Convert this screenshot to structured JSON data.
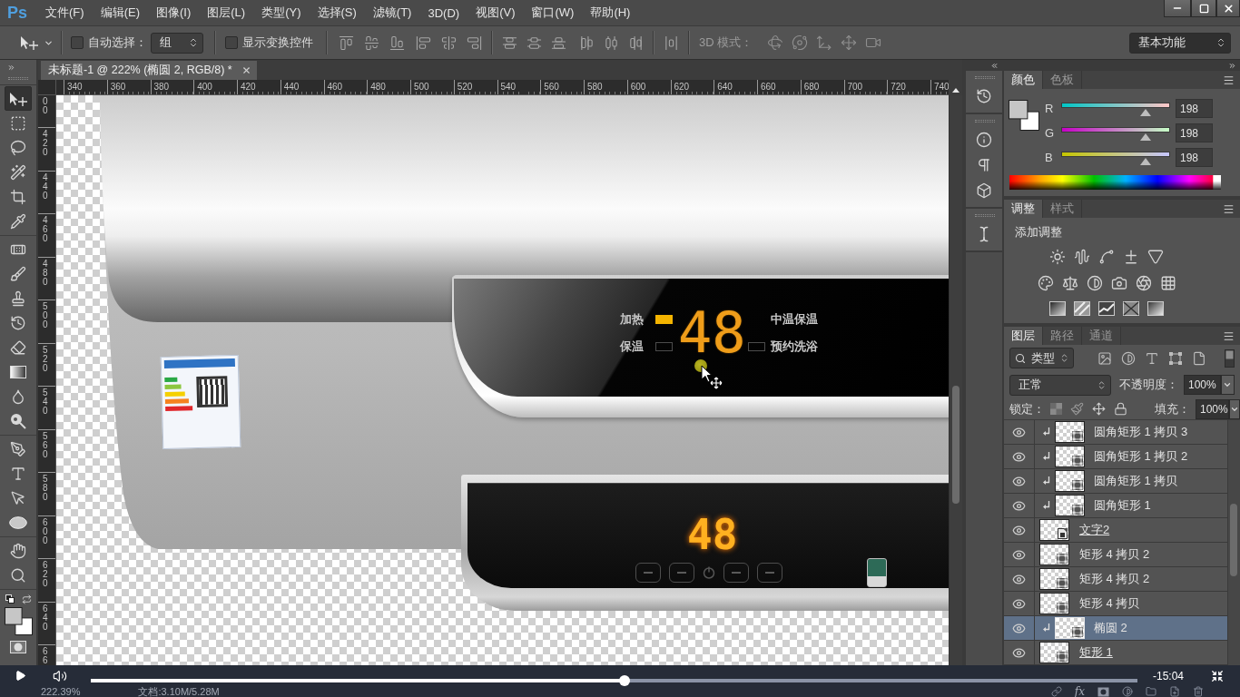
{
  "app_logo": "Ps",
  "menu": [
    "文件(F)",
    "编辑(E)",
    "图像(I)",
    "图层(L)",
    "类型(Y)",
    "选择(S)",
    "滤镜(T)",
    "3D(D)",
    "视图(V)",
    "窗口(W)",
    "帮助(H)"
  ],
  "options_bar": {
    "auto_select": {
      "label": "自动选择：",
      "checked": false
    },
    "auto_select_target": "组",
    "show_transform": {
      "label": "显示变换控件",
      "checked": false
    },
    "mode_3d_label": "3D 模式：",
    "workspace": "基本功能"
  },
  "tool_groups": [
    {
      "tools": [
        {
          "kind": "move",
          "selected": true
        },
        {
          "kind": "marquee",
          "selected": false
        },
        {
          "kind": "lasso",
          "selected": false
        },
        {
          "kind": "wand",
          "selected": false
        },
        {
          "kind": "crop",
          "selected": false
        },
        {
          "kind": "eyedropper",
          "selected": false
        }
      ]
    },
    {
      "tools": [
        {
          "kind": "healing",
          "selected": false
        },
        {
          "kind": "brush",
          "selected": false
        },
        {
          "kind": "stamp",
          "selected": false
        },
        {
          "kind": "history",
          "selected": false
        },
        {
          "kind": "eraser",
          "selected": false
        },
        {
          "kind": "gradient",
          "selected": false
        },
        {
          "kind": "blur",
          "selected": false
        },
        {
          "kind": "dodge",
          "selected": false
        }
      ]
    },
    {
      "tools": [
        {
          "kind": "pen",
          "selected": false
        },
        {
          "kind": "type",
          "selected": false
        },
        {
          "kind": "path",
          "selected": false
        },
        {
          "kind": "ellipse",
          "selected": false
        }
      ]
    },
    {
      "tools": [
        {
          "kind": "hand",
          "selected": false
        },
        {
          "kind": "zoom",
          "selected": false
        }
      ]
    }
  ],
  "document_tab": {
    "title": "未标题-1 @ 222% (椭圆 2, RGB/8) *"
  },
  "rulers": {
    "horizontal": [
      "340",
      "360",
      "380",
      "400",
      "420",
      "440",
      "460",
      "480",
      "500",
      "520",
      "540",
      "560",
      "580",
      "600",
      "620",
      "640",
      "660",
      "680",
      "700",
      "720",
      "740"
    ],
    "vertical": [
      "00",
      "420",
      "440",
      "460",
      "480",
      "500",
      "520",
      "540",
      "560",
      "580",
      "600",
      "620",
      "640",
      "66"
    ]
  },
  "canvas": {
    "display": {
      "reading": "48",
      "left_indicators": [
        {
          "label": "加热",
          "on": true
        },
        {
          "label": "保温",
          "on": false
        }
      ],
      "right_indicators": [
        {
          "label": "中温保温"
        },
        {
          "label": "预约洗浴",
          "on": false
        }
      ]
    },
    "reference_panel": {
      "reading": "48"
    }
  },
  "status_bar": {
    "zoom": "222.39%",
    "document": "文档:3.10M/5.28M"
  },
  "color_panel": {
    "tabs": [
      {
        "label": "颜色",
        "selected": true
      },
      {
        "label": "色板",
        "selected": false
      }
    ],
    "channels": [
      {
        "name": "R",
        "value": "198",
        "level": 0.776
      },
      {
        "name": "G",
        "value": "198",
        "level": 0.776
      },
      {
        "name": "B",
        "value": "198",
        "level": 0.776
      }
    ]
  },
  "adjustments_panel": {
    "tabs": [
      {
        "label": "调整",
        "selected": true
      },
      {
        "label": "样式",
        "selected": false
      }
    ],
    "heading": "添加调整"
  },
  "layers_panel": {
    "tabs": [
      {
        "label": "图层",
        "selected": true
      },
      {
        "label": "路径",
        "selected": false
      },
      {
        "label": "通道",
        "selected": false
      }
    ],
    "filter": "类型",
    "blend_mode": "正常",
    "opacity_label": "不透明度：",
    "opacity": "100%",
    "lock_label": "锁定：",
    "fill_label": "填充：",
    "fill": "100%",
    "layers": [
      {
        "name": "圆角矩形 1 拷贝 3",
        "kind": "shape",
        "visible": true,
        "clipped": true,
        "clip_base": false,
        "selected": false
      },
      {
        "name": "圆角矩形 1 拷贝 2",
        "kind": "shape",
        "visible": true,
        "clipped": true,
        "clip_base": false,
        "selected": false
      },
      {
        "name": "圆角矩形 1 拷贝",
        "kind": "shape",
        "visible": true,
        "clipped": true,
        "clip_base": false,
        "selected": false
      },
      {
        "name": "圆角矩形 1",
        "kind": "shape",
        "visible": true,
        "clipped": true,
        "clip_base": false,
        "selected": false
      },
      {
        "name": "文字2",
        "kind": "smart",
        "visible": true,
        "clipped": false,
        "clip_base": true,
        "selected": false
      },
      {
        "name": "矩形 4 拷贝 2",
        "kind": "shape",
        "visible": true,
        "clipped": false,
        "clip_base": false,
        "selected": false
      },
      {
        "name": "矩形 4 拷贝 2",
        "kind": "shape",
        "visible": true,
        "clipped": false,
        "clip_base": false,
        "selected": false
      },
      {
        "name": "矩形 4 拷贝",
        "kind": "shape",
        "visible": true,
        "clipped": false,
        "clip_base": false,
        "selected": false
      },
      {
        "name": "椭圆 2",
        "kind": "shape",
        "visible": true,
        "clipped": true,
        "clip_base": false,
        "selected": true
      },
      {
        "name": "矩形 1",
        "kind": "shape",
        "visible": true,
        "clipped": false,
        "clip_base": true,
        "selected": false
      }
    ],
    "effects_button": "fx"
  },
  "player": {
    "level": 0.51,
    "time": "-15:04"
  }
}
